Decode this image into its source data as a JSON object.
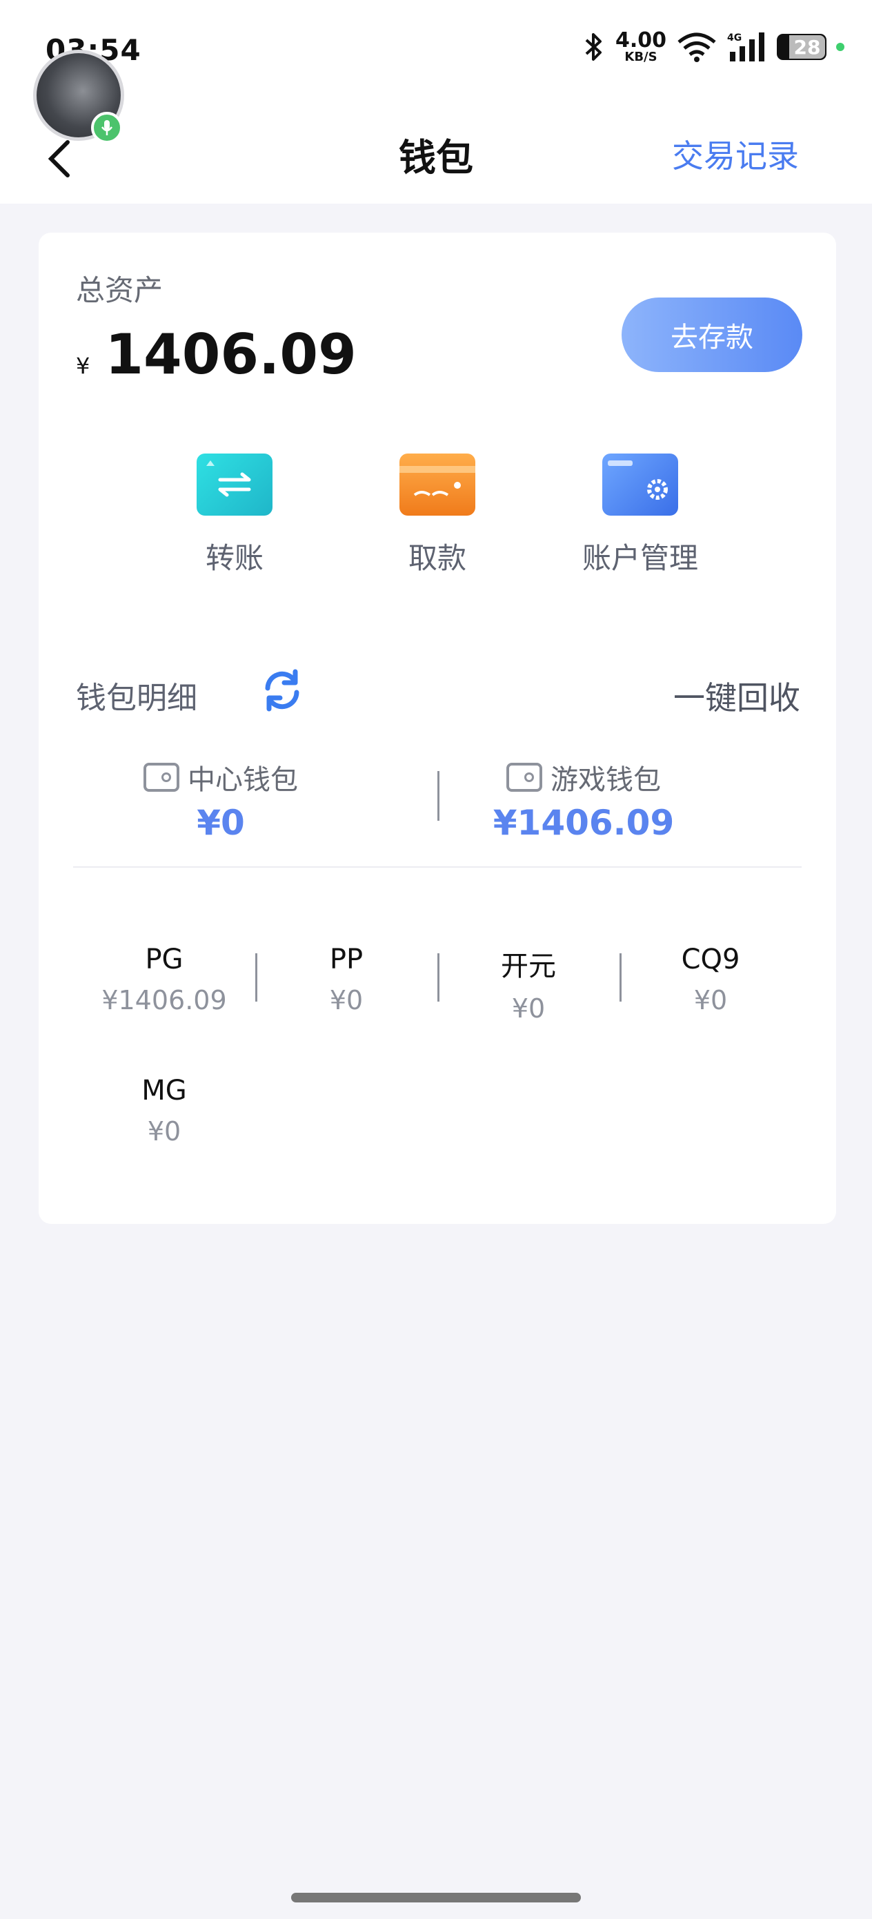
{
  "status_bar": {
    "time": "03:54",
    "net_speed_value": "4.00",
    "net_speed_unit": "KB/S",
    "battery_level": "28",
    "icons": [
      "bluetooth-icon",
      "wifi-icon",
      "cellular-signal-icon",
      "battery-icon"
    ]
  },
  "header": {
    "title": "钱包",
    "right_link": "交易记录"
  },
  "summary": {
    "total_label": "总资产",
    "currency_symbol": "¥",
    "total_amount": "1406.09",
    "deposit_button": "去存款"
  },
  "actions": [
    {
      "label": "转账",
      "icon": "transfer-icon"
    },
    {
      "label": "取款",
      "icon": "withdraw-card-icon"
    },
    {
      "label": "账户管理",
      "icon": "account-settings-card-icon"
    }
  ],
  "wallet_detail": {
    "label": "钱包明细",
    "recycle_label": "一键回收",
    "center_wallet": {
      "name": "中心钱包",
      "value": "¥0"
    },
    "game_wallet": {
      "name": "游戏钱包",
      "value": "¥1406.09"
    }
  },
  "game_balances": [
    {
      "name": "PG",
      "value": "¥1406.09"
    },
    {
      "name": "PP",
      "value": "¥0"
    },
    {
      "name": "开元",
      "value": "¥0"
    },
    {
      "name": "CQ9",
      "value": "¥0"
    },
    {
      "name": "MG",
      "value": "¥0"
    }
  ],
  "colors": {
    "accent": "#4a7cf0",
    "wallet_value": "#5a84ef",
    "background": "#f4f4f9"
  }
}
